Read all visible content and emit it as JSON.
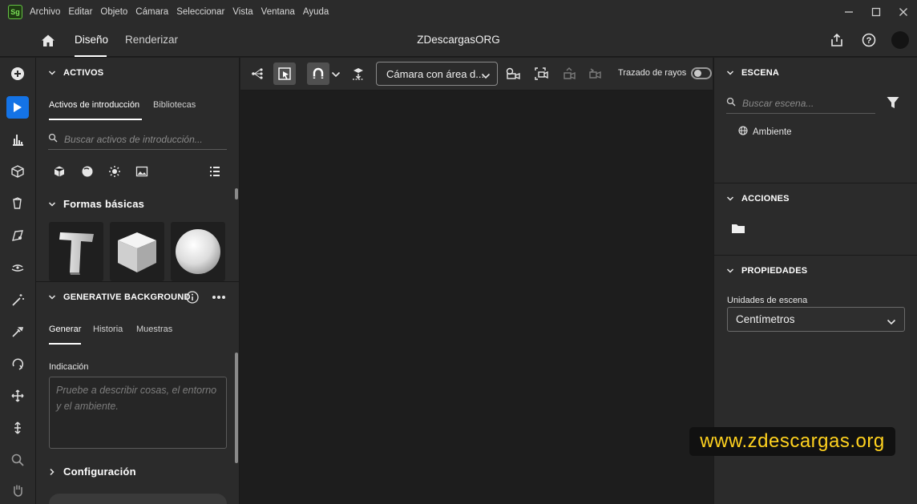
{
  "app": {
    "logo_text": "Sg",
    "title": "ZDescargasORG"
  },
  "menu": [
    "Archivo",
    "Editar",
    "Objeto",
    "Cámara",
    "Seleccionar",
    "Vista",
    "Ventana",
    "Ayuda"
  ],
  "header": {
    "tabs": [
      "Diseño",
      "Renderizar"
    ],
    "active_tab": "Diseño"
  },
  "tool_rail": {
    "active_tool": "select-tool",
    "tools": [
      "add-icon",
      "select-icon",
      "chart-tool-icon",
      "cube-icon",
      "bucket-icon",
      "camera-select-icon",
      "horizon-icon",
      "magic-wand-icon",
      "eyedropper-icon",
      "orbit-icon",
      "pan-icon",
      "dolly-icon",
      "zoom-icon",
      "hand-icon"
    ]
  },
  "assets": {
    "section_title": "ACTIVOS",
    "tabs": [
      "Activos de introducción",
      "Bibliotecas"
    ],
    "search_placeholder": "Buscar activos de introducción...",
    "filter_icons": [
      "model-icon",
      "material-icon",
      "light-icon",
      "image-icon",
      "list-view-icon"
    ],
    "group_title": "Formas básicas",
    "shapes": [
      "text-shape",
      "cube-shape",
      "sphere-shape"
    ]
  },
  "generative": {
    "section_title": "GENERATIVE BACKGROUND",
    "tabs": [
      "Generar",
      "Historia",
      "Muestras"
    ],
    "prompt_label": "Indicación",
    "prompt_placeholder": "Pruebe a describir cosas, el entorno y el ambiente.",
    "config_label": "Configuración"
  },
  "viewport": {
    "camera_value": "Cámara con área d...",
    "raytrace_label": "Trazado de rayos",
    "raytrace_on": false
  },
  "scene": {
    "section_title": "ESCENA",
    "search_placeholder": "Buscar escena...",
    "items": [
      "Ambiente"
    ]
  },
  "actions": {
    "section_title": "ACCIONES"
  },
  "properties": {
    "section_title": "PROPIEDADES",
    "units_label": "Unidades de escena",
    "units_value": "Centímetros"
  },
  "watermark": "www.zdescargas.org",
  "colors": {
    "accent": "#1473e6",
    "panel": "#2b2b2b",
    "canvas": "#1d1d1d",
    "watermark_text": "#ffd21f"
  }
}
